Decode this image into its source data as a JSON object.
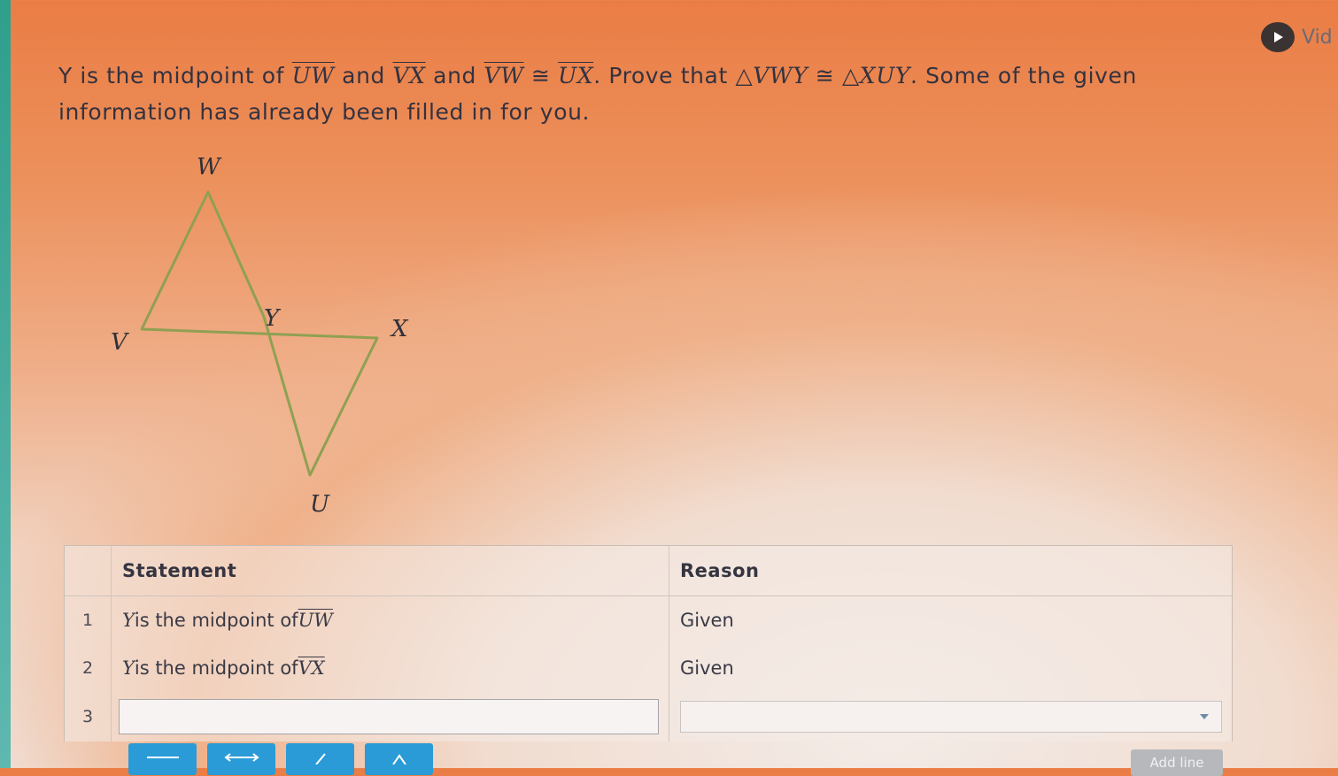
{
  "header": {
    "video_label": "Vid"
  },
  "problem": {
    "p1": "Y is the midpoint of ",
    "seg1": "UW",
    "p2": " and ",
    "seg2": "VX",
    "p3": " and ",
    "seg3": "VW",
    "p4": " ≅ ",
    "seg4": "UX",
    "p5": ". Prove that ",
    "tri1": "△VWY",
    "p6": " ≅ ",
    "tri2": "△XUY",
    "p7": ". Some of the given information has already been filled in for you."
  },
  "figure": {
    "labels": {
      "W": "W",
      "Y": "Y",
      "V": "V",
      "X": "X",
      "U": "U"
    }
  },
  "proof": {
    "headers": {
      "statement": "Statement",
      "reason": "Reason"
    },
    "rows": [
      {
        "num": "1",
        "var": "Y",
        "text": " is the midpoint of ",
        "seg": "UW",
        "reason": "Given"
      },
      {
        "num": "2",
        "var": "Y",
        "text": " is the midpoint of ",
        "seg": "VX",
        "reason": "Given"
      }
    ],
    "input_row": {
      "num": "3",
      "statement_value": "",
      "reason_value": ""
    }
  },
  "toolbar": {
    "add_line_label": "Add line"
  },
  "colors": {
    "figure_stroke": "#8fa052",
    "tool_blue": "#2a9bd6"
  }
}
